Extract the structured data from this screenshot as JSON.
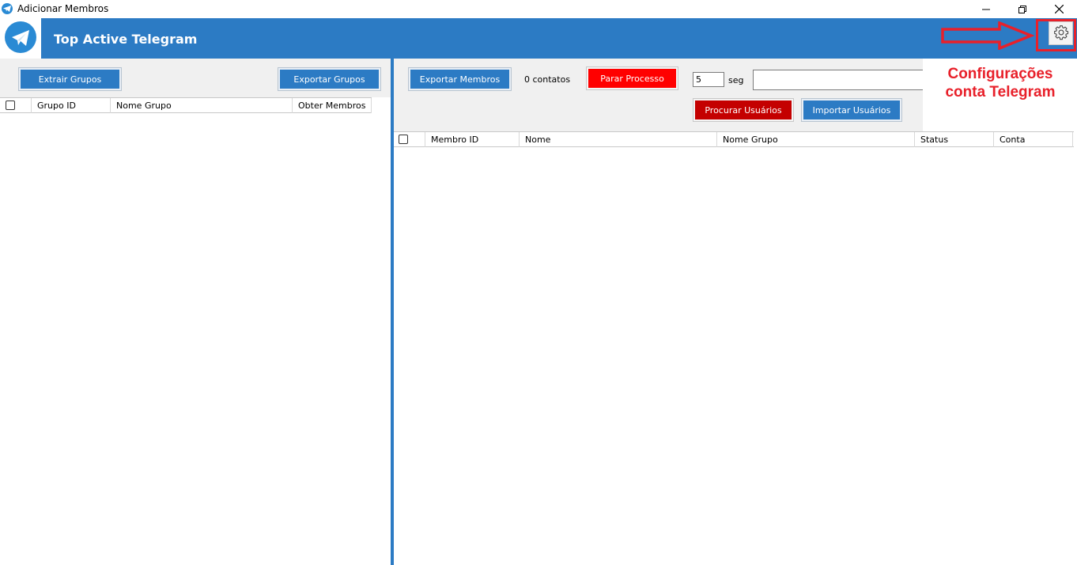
{
  "window": {
    "title": "Adicionar Membros",
    "icon": "telegram-icon"
  },
  "header": {
    "title": "Top Active Telegram",
    "logo": "telegram-logo-icon",
    "settings_icon": "gear-icon"
  },
  "annotation": {
    "line1": "Configurações",
    "line2": "conta Telegram",
    "color": "#e8202a"
  },
  "left": {
    "extract_button": "Extrair Grupos",
    "export_button": "Exportar Grupos",
    "columns": [
      "Grupo ID",
      "Nome Grupo",
      "Obter Membros"
    ]
  },
  "right": {
    "export_button": "Exportar Membros",
    "contacts_count": "0 contatos",
    "stop_button": "Parar Processo",
    "delay_value": "5",
    "delay_unit": "seg",
    "search_button": "Procurar Usuários",
    "import_button": "Importar Usuários",
    "columns": [
      "Membro ID",
      "Nome",
      "Nome Grupo",
      "Status",
      "Conta"
    ]
  },
  "colors": {
    "brand_blue": "#2c7bc4",
    "stop_red": "#ff0000",
    "search_red": "#c40000"
  }
}
